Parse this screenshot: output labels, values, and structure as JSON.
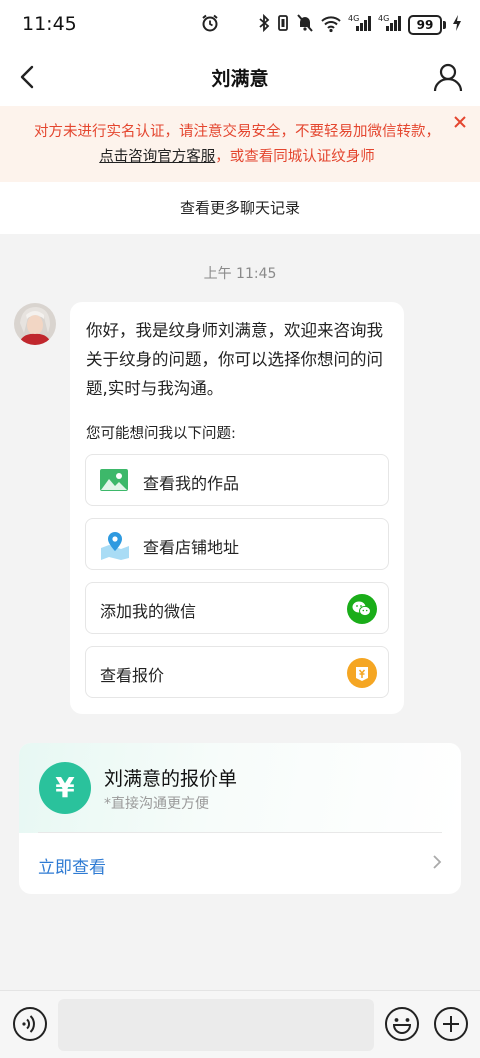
{
  "status_bar": {
    "time": "11:45",
    "network": "4G",
    "battery": "99"
  },
  "nav": {
    "title": "刘满意"
  },
  "warning": {
    "text_before": "对方未进行实名认证，请注意交易安全，不要轻易加微信转款，",
    "link": "点击咨询官方客服",
    "text_after": "，或查看同城认证纹身师"
  },
  "chat": {
    "more_history": "查看更多聊天记录",
    "time_label": "上午 11:45",
    "greeting": "你好，我是纹身师刘满意，欢迎来咨询我关于纹身的问题，你可以选择你想问的问题,实时与我沟通。",
    "hint": "您可能想问我以下问题:",
    "options": [
      {
        "label": "查看我的作品",
        "icon": "gallery-icon"
      },
      {
        "label": "查看店铺地址",
        "icon": "map-pin-icon"
      },
      {
        "label": "添加我的微信",
        "icon": "wechat-icon"
      },
      {
        "label": "查看报价",
        "icon": "price-tag-icon"
      }
    ]
  },
  "quote_card": {
    "icon_symbol": "¥",
    "title": "刘满意的报价单",
    "subtitle": "*直接沟通更方便",
    "action": "立即查看"
  },
  "input_bar": {
    "placeholder": ""
  },
  "colors": {
    "warning_text": "#e4462f",
    "quote_accent": "#2ac29c",
    "link_blue": "#2f7bd3",
    "wechat_green": "#1aad19",
    "price_orange": "#f5a623"
  }
}
